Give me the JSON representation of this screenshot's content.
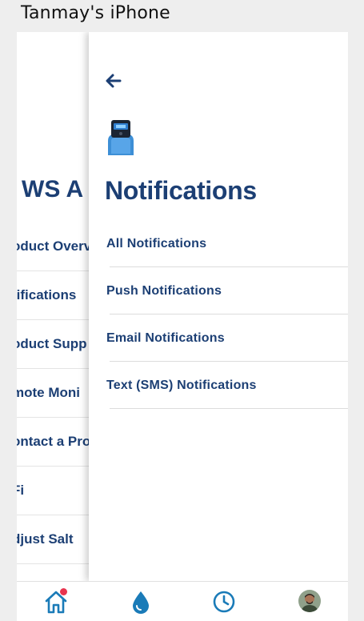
{
  "window": {
    "title": "Tanmay's iPhone"
  },
  "background_menu": {
    "heading": "WS A",
    "items": [
      {
        "label": "oduct Overv"
      },
      {
        "label": "tifications"
      },
      {
        "label": "oduct Supp"
      },
      {
        "label": "mote Moni"
      },
      {
        "label": "ontact a Pro"
      },
      {
        "label": "Fi"
      },
      {
        "label": "djust Salt"
      }
    ]
  },
  "drawer": {
    "back_icon": "arrow-left-icon",
    "device_icon": "water-softener-device-icon",
    "title": "Notifications",
    "items": [
      {
        "label": "All Notifications"
      },
      {
        "label": "Push Notifications"
      },
      {
        "label": "Email Notifications"
      },
      {
        "label": "Text (SMS) Notifications"
      }
    ]
  },
  "tabbar": {
    "tabs": [
      {
        "icon": "home-icon",
        "badge": true
      },
      {
        "icon": "water-drop-icon"
      },
      {
        "icon": "clock-icon"
      },
      {
        "icon": "avatar"
      }
    ]
  },
  "colors": {
    "primary": "#1c3f74",
    "accent": "#1a7bb8",
    "badge": "#e8344e"
  }
}
